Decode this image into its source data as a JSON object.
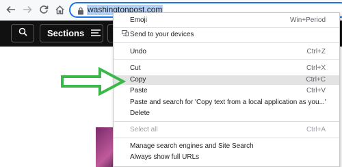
{
  "browser": {
    "url": "washingtonpost.com",
    "icons": [
      "back-arrow-icon",
      "forward-arrow-icon",
      "reload-icon",
      "home-icon",
      "lock-icon"
    ]
  },
  "site": {
    "sections_label": "Sections",
    "icons": [
      "search-icon",
      "hamburger-menu-icon"
    ]
  },
  "context_menu": {
    "emoji": {
      "label": "Emoji",
      "shortcut": "Win+Period"
    },
    "send": {
      "label": "Send to your devices"
    },
    "undo": {
      "label": "Undo",
      "shortcut": "Ctrl+Z"
    },
    "cut": {
      "label": "Cut",
      "shortcut": "Ctrl+X"
    },
    "copy": {
      "label": "Copy",
      "shortcut": "Ctrl+C"
    },
    "paste": {
      "label": "Paste",
      "shortcut": "Ctrl+V"
    },
    "paste_search": {
      "label": "Paste and search for 'Copy text from a local application as you...'"
    },
    "delete": {
      "label": "Delete"
    },
    "select_all": {
      "label": "Select all",
      "shortcut": "Ctrl+A"
    },
    "manage_search": {
      "label": "Manage search engines and Site Search"
    },
    "show_urls": {
      "label": "Always show full URLs"
    }
  },
  "colors": {
    "address_focus": "#1a73e8",
    "url_selection": "#b3d1f7",
    "site_header": "#111111",
    "arrow_green": "#3cb84a",
    "menu_highlight": "#e3e3e3"
  }
}
